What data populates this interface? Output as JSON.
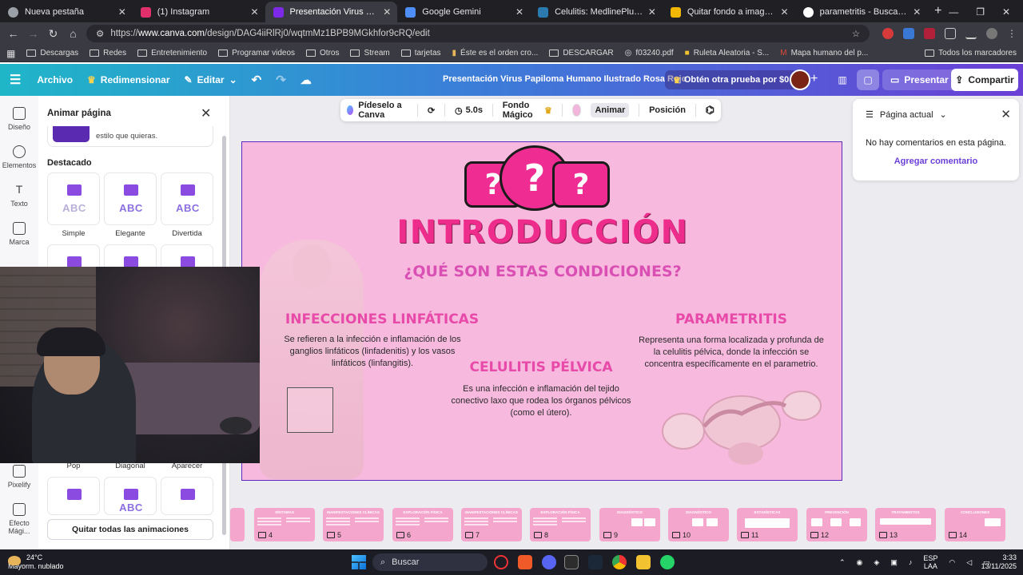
{
  "browser": {
    "tabs": [
      {
        "title": "Nueva pestaña",
        "color": "#9aa0a6",
        "active": false
      },
      {
        "title": "(1) Instagram",
        "color": "#e1306c",
        "active": false
      },
      {
        "title": "Presentación Virus Papiloma H",
        "color": "#7d2ae8",
        "active": true
      },
      {
        "title": "Google Gemini",
        "color": "#4f8ef7",
        "active": false
      },
      {
        "title": "Celulitis: MedlinePlus enciclope",
        "color": "#2a7ab0",
        "active": false
      },
      {
        "title": "Quitar fondo a imagenes onlin",
        "color": "#f2b705",
        "active": false
      },
      {
        "title": "parametritis - Buscar con Goog",
        "color": "#ffffff",
        "active": false
      }
    ],
    "url_prefix": "https://",
    "url_host": "www.canva.com",
    "url_path": "/design/DAG4iiRlRj0/wqtmMz1BPB9MGkhfor9cRQ/edit",
    "bookmarks": [
      "Descargas",
      "Redes",
      "Entretenimiento",
      "Programar videos",
      "Otros",
      "Stream",
      "tarjetas",
      "Éste es el orden cro...",
      "DESCARGAR",
      "f03240.pdf",
      "Ruleta Aleatoria - S...",
      "Mapa humano del p..."
    ],
    "bookmarks_right": "Todos los marcadores"
  },
  "canva": {
    "menu": {
      "archivo": "Archivo",
      "redimensionar": "Redimensionar",
      "editar": "Editar"
    },
    "doc_title": "Presentación Virus Papiloma Humano Ilustrado Rosa Rojo",
    "trial": "Obtén otra prueba por $0",
    "present": "Presentar",
    "share": "Compartir"
  },
  "rail": [
    "Diseño",
    "Elementos",
    "Texto",
    "Marca",
    "Pixelify",
    "Efecto Mági..."
  ],
  "panel": {
    "title": "Animar página",
    "promo_text": "estilo que quieras.",
    "section": "Destacado",
    "row1": [
      {
        "label": "Simple"
      },
      {
        "label": "Elegante"
      },
      {
        "label": "Divertida"
      }
    ],
    "row3": [
      "Pop",
      "Diagonal",
      "Aparecer"
    ],
    "abc": "ABC",
    "remove_all": "Quitar todas las animaciones"
  },
  "toolbar": {
    "magic": "Pídeselo a Canva",
    "duration": "5.0s",
    "background": "Fondo Mágico",
    "animate": "Animar",
    "position": "Posición"
  },
  "slide": {
    "title": "INTRODUCCIÓN",
    "subtitle": "¿QUÉ SON ESTAS CONDICIONES?",
    "q_mark": "?",
    "col1": {
      "heading": "INFECCIONES LINFÁTICAS",
      "text": "Se refieren a la infección e inflamación de los ganglios linfáticos (linfadenitis) y los vasos linfáticos (linfangitis)."
    },
    "col2": {
      "heading": "CELULITIS PÉLVICA",
      "text": "Es una infección e inflamación del tejido conectivo laxo que rodea los órganos pélvicos (como el útero)."
    },
    "col3": {
      "heading": "PARAMETRITIS",
      "text": "Representa una forma localizada y profunda de la celulitis pélvica, donde la infección se concentra específicamente en el parametrio."
    }
  },
  "comments": {
    "header": "Página actual",
    "empty": "No hay comentarios en esta página.",
    "add": "Agregar comentario"
  },
  "thumbnails": [
    {
      "num": "",
      "title": ""
    },
    {
      "num": "4",
      "title": "SÍNTOMAS"
    },
    {
      "num": "5",
      "title": "MANIFESTACIONES CLÍNICAS"
    },
    {
      "num": "6",
      "title": "EXPLORACIÓN FÍSICA"
    },
    {
      "num": "7",
      "title": "MANIFESTACIONES CLÍNICAS"
    },
    {
      "num": "8",
      "title": "EXPLORACIÓN FÍSICA"
    },
    {
      "num": "9",
      "title": "DIAGNÓSTICO"
    },
    {
      "num": "10",
      "title": "DIAGNÓSTICO"
    },
    {
      "num": "11",
      "title": "ESTADÍSTICAS"
    },
    {
      "num": "12",
      "title": "PREVENCIÓN"
    },
    {
      "num": "13",
      "title": "TRATAMIENTOS"
    },
    {
      "num": "14",
      "title": "CONCLUSIONES"
    }
  ],
  "taskbar": {
    "temp": "24°C",
    "weather": "Mayorm. nublado",
    "search": "Buscar",
    "lang1": "ESP",
    "lang2": "LAA",
    "time": "3:33",
    "date": "13/11/2025"
  }
}
